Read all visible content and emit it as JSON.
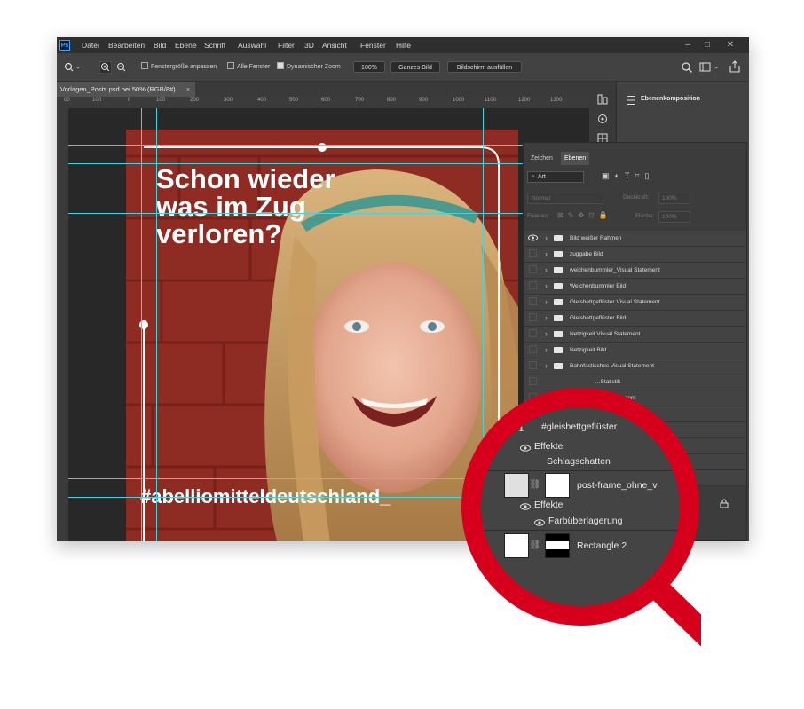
{
  "app": {
    "logo": "Ps",
    "menu": [
      "Datei",
      "Bearbeiten",
      "Bild",
      "Ebene",
      "Schrift",
      "Auswahl",
      "Filter",
      "3D",
      "Ansicht",
      "Fenster",
      "Hilfe"
    ],
    "window_controls": [
      "–",
      "□",
      "✕"
    ]
  },
  "options": {
    "fit_window": "Fenstergröße anpassen",
    "all_windows": "Alle Fenster",
    "dynamic_zoom": "Dynamischer Zoom",
    "zoom_value": "100%",
    "whole_image": "Ganzes Bild",
    "fill_screen": "Bildschirm ausfüllen"
  },
  "document": {
    "tab_title": "Vorlagen_Posts.psd bei 50% (RGB/8#)",
    "tab_close": "×",
    "ruler_ticks": [
      "00",
      "100",
      "0",
      "100",
      "200",
      "300",
      "400",
      "500",
      "600",
      "700",
      "800",
      "900",
      "1000",
      "1100",
      "1200",
      "1300"
    ]
  },
  "artwork": {
    "headline": [
      "Schon wieder",
      "was im Zug",
      "verloren?"
    ],
    "hashtag": "#abelliomitteldeutschland_"
  },
  "side_panel": {
    "composition_label": "Ebenenkomposition"
  },
  "layers_panel": {
    "tabs": [
      "Zeichen",
      "Ebenen"
    ],
    "filter_kind": "Art",
    "blend_mode": "Normal",
    "opacity_label": "Deckkraft:",
    "opacity_value": "100%",
    "lock_label": "Fixieren:",
    "fill_label": "Fläche:",
    "fill_value": "100%",
    "layers": [
      "Bild weißer Rahmen",
      "zuggabe Bild",
      "weichenbummler_Visual Statement",
      "Weichenbummler Bild",
      "Gleisbettgeflüster Visual Statement",
      "Gleisbettgeflüster Bild",
      "Netzigkeit Visual Statement",
      "Netzigkeit Bild",
      "Bahnfastisches Visual Statement",
      "…Statistik",
      "…tement"
    ]
  },
  "magnifier": {
    "text_layer": "#gleisbettgeflüster",
    "effects_1": "Effekte",
    "effect_1": "Schlagschatten",
    "frame_layer": "post-frame_ohne_v",
    "effects_2": "Effekte",
    "effect_2": "Farbüberlagerung",
    "rect_layer": "Rectangle 2"
  },
  "colors": {
    "brand_red": "#d6001c",
    "guide_cyan": "#3fd6e0",
    "ps_dark": "#535353"
  }
}
